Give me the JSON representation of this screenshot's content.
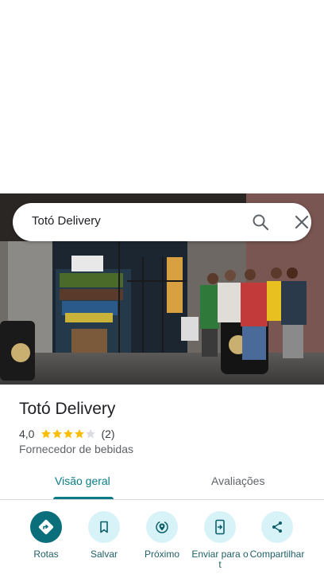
{
  "search": {
    "query": "Totó Delivery"
  },
  "place": {
    "name": "Totó Delivery",
    "rating": "4,0",
    "rating_value": 4,
    "rating_max": 5,
    "review_count": "(2)",
    "category": "Fornecedor de bebidas"
  },
  "tabs": [
    {
      "label": "Visão geral",
      "active": true
    },
    {
      "label": "Avaliações",
      "active": false
    }
  ],
  "actions": [
    {
      "label": "Rotas",
      "icon": "directions-icon"
    },
    {
      "label": "Salvar",
      "icon": "bookmark-icon"
    },
    {
      "label": "Próximo",
      "icon": "nearby-icon"
    },
    {
      "label": "Enviar para o t",
      "icon": "send-to-phone-icon"
    },
    {
      "label": "Compartilhar",
      "icon": "share-icon"
    }
  ],
  "colors": {
    "accent": "#0b7c86",
    "primary_button": "#0b6f7b",
    "action_bg": "#d8f3f8",
    "star": "#fbbc04",
    "star_empty": "#dadce0"
  }
}
